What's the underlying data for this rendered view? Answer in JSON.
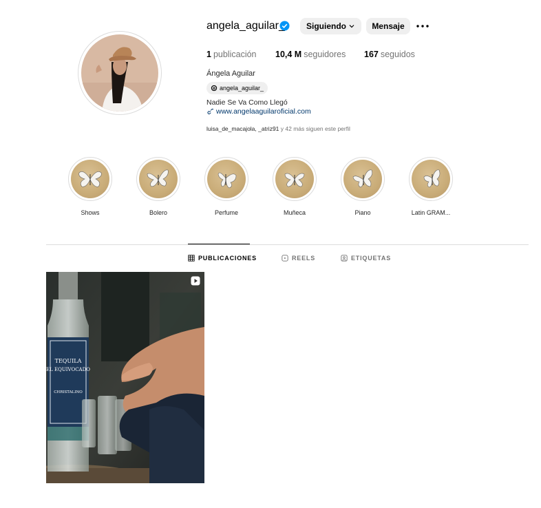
{
  "profile": {
    "username": "angela_aguilar_",
    "following_button": "Siguiendo",
    "message_button": "Mensaje",
    "stats": {
      "posts_count": "1",
      "posts_label": "publicación",
      "followers_count": "10,4 M",
      "followers_label": "seguidores",
      "following_count": "167",
      "following_label": "seguidos"
    },
    "full_name": "Ángela Aguilar",
    "threads_handle": "angela_aguilar_",
    "bio": "Nadie Se Va Como Llegó",
    "website": "www.angelaaguilaroficial.com",
    "followed_by": {
      "user1": "luisa_de_macajola",
      "sep": ", ",
      "user2": "_atriz91",
      "suffix": " y 42 más siguen este perfil"
    }
  },
  "highlights": [
    {
      "label": "Shows"
    },
    {
      "label": "Bolero"
    },
    {
      "label": "Perfume"
    },
    {
      "label": "Muñeca"
    },
    {
      "label": "Piano"
    },
    {
      "label": "Latin GRAM..."
    }
  ],
  "tabs": [
    {
      "label": "PUBLICACIONES"
    },
    {
      "label": "REELS"
    },
    {
      "label": "ETIQUETAS"
    }
  ],
  "post": {
    "bottle_text1": "TEQUILA",
    "bottle_text2": "EL EQUIVOCADO",
    "bottle_text3": "CHRISTALINO"
  },
  "colors": {
    "verified": "#0095f6",
    "link": "#00376b",
    "button_bg": "#efefef"
  }
}
